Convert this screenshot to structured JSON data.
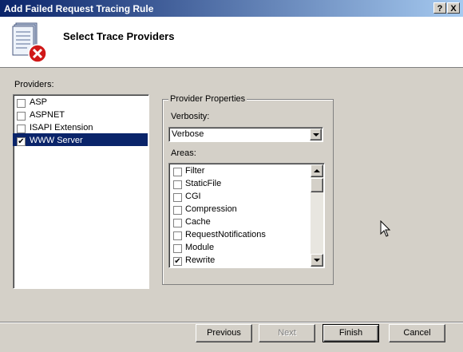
{
  "window": {
    "title": "Add Failed Request Tracing Rule",
    "help_label": "?",
    "close_label": "X"
  },
  "header": {
    "heading": "Select Trace Providers"
  },
  "providers": {
    "label": "Providers:",
    "items": [
      {
        "label": "ASP",
        "checked": false
      },
      {
        "label": "ASPNET",
        "checked": false
      },
      {
        "label": "ISAPI Extension",
        "checked": false
      },
      {
        "label": "WWW Server",
        "checked": true,
        "selected": true
      }
    ]
  },
  "properties": {
    "group_title": "Provider Properties",
    "verbosity_label": "Verbosity:",
    "verbosity_value": "Verbose",
    "areas_label": "Areas:",
    "areas": [
      {
        "label": "Filter",
        "checked": false
      },
      {
        "label": "StaticFile",
        "checked": false
      },
      {
        "label": "CGI",
        "checked": false
      },
      {
        "label": "Compression",
        "checked": false
      },
      {
        "label": "Cache",
        "checked": false
      },
      {
        "label": "RequestNotifications",
        "checked": false
      },
      {
        "label": "Module",
        "checked": false
      },
      {
        "label": "Rewrite",
        "checked": true
      }
    ]
  },
  "footer": {
    "previous_label": "Previous",
    "next_label": "Next",
    "finish_label": "Finish",
    "cancel_label": "Cancel"
  },
  "colors": {
    "selection": "#0a246a",
    "face": "#d4d0c8",
    "title_start": "#0a246a",
    "title_end": "#a6caf0"
  }
}
